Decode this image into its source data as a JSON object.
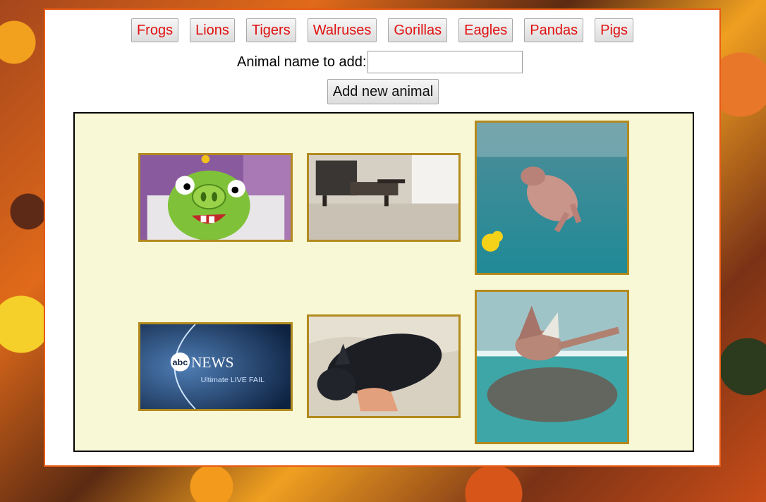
{
  "animal_buttons": [
    "Frogs",
    "Lions",
    "Tigers",
    "Walruses",
    "Gorillas",
    "Eagles",
    "Pandas",
    "Pigs"
  ],
  "add_form": {
    "label": "Animal name to add:",
    "input_value": "",
    "button_label": "Add new animal"
  },
  "gallery": {
    "images": [
      {
        "subject": "cartoon green pig in crib"
      },
      {
        "subject": "living room floor with chair"
      },
      {
        "subject": "pig swimming underwater with rubber duck"
      },
      {
        "subject": "news broadcast logo",
        "text_line1": "abc",
        "text_line2": "NEWS",
        "text_line3": "Ultimate LIVE FAIL"
      },
      {
        "subject": "black piglet being petted"
      },
      {
        "subject": "pig swimming at water surface"
      }
    ]
  },
  "colors": {
    "button_text": "#e01010",
    "panel_border": "#e85a12",
    "gallery_bg": "#f9f8d6",
    "thumb_border": "#b38a1e"
  }
}
